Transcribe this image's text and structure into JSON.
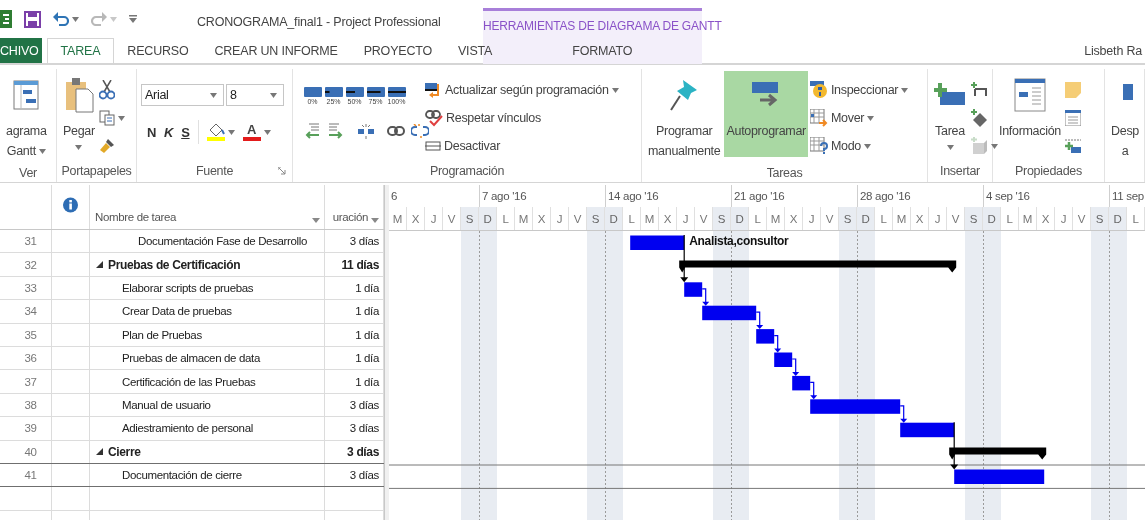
{
  "window": {
    "title": "CRONOGRAMA_final1 - Project Professional",
    "context_title": "HERRAMIENTAS DE DIAGRAMA DE GANTT",
    "user": "Lisbeth Ra"
  },
  "quick_access": [
    {
      "kind": "app",
      "disabled": false
    },
    {
      "kind": "save",
      "disabled": false
    },
    {
      "kind": "undo",
      "disabled": false
    },
    {
      "kind": "redo",
      "disabled": true
    },
    {
      "kind": "customize",
      "disabled": false
    }
  ],
  "tabs": [
    {
      "label": "CHIVO",
      "kind": "file",
      "selected": false
    },
    {
      "label": "TAREA",
      "kind": "tab",
      "selected": true
    },
    {
      "label": "RECURSO",
      "kind": "tab",
      "selected": false
    },
    {
      "label": "CREAR UN INFORME",
      "kind": "tab",
      "selected": false
    },
    {
      "label": "PROYECTO",
      "kind": "tab",
      "selected": false
    },
    {
      "label": "VISTA",
      "kind": "tab",
      "selected": false
    },
    {
      "label": "FORMATO",
      "kind": "contextual",
      "selected": false
    }
  ],
  "ribbon": {
    "groups": [
      {
        "label": "Ver",
        "items": [
          {
            "kind": "large",
            "lines": [
              "agrama",
              "Gantt"
            ],
            "dropdown": true,
            "selected": false
          }
        ]
      },
      {
        "label": "Portapapeles",
        "items": [
          {
            "kind": "large",
            "lines": [
              "Pegar"
            ],
            "dropdown": true,
            "selected": false
          },
          {
            "kind": "stack",
            "items": [
              {
                "dropdown": false
              },
              {
                "dropdown": true
              },
              {
                "dropdown": false
              }
            ]
          }
        ]
      },
      {
        "label": "Fuente",
        "items": [
          {
            "kind": "font",
            "font": "Arial",
            "size": "8",
            "styles": [
              "N",
              "K",
              "S"
            ],
            "font_color": "A"
          }
        ]
      },
      {
        "label": "Programación",
        "items": [
          {
            "kind": "progress_grid",
            "percents": [
              "0%",
              "25%",
              "50%",
              "75%",
              "100%"
            ]
          },
          {
            "kind": "stack",
            "items": [
              {
                "label": "Actualizar según programación",
                "dropdown": true
              },
              {
                "label": "Respetar vínculos",
                "dropdown": false
              },
              {
                "label": "Desactivar",
                "dropdown": false
              }
            ]
          }
        ]
      },
      {
        "label": "Tareas",
        "items": [
          {
            "kind": "large",
            "lines": [
              "Programar",
              "manualmente"
            ],
            "dropdown": false,
            "selected": false
          },
          {
            "kind": "large",
            "lines": [
              "Autoprogramar"
            ],
            "dropdown": false,
            "selected": true
          },
          {
            "kind": "stack",
            "items": [
              {
                "label": "Inspeccionar",
                "dropdown": true
              },
              {
                "label": "Mover",
                "dropdown": true
              },
              {
                "label": "Modo",
                "dropdown": true
              }
            ]
          }
        ]
      },
      {
        "label": "Insertar",
        "items": [
          {
            "kind": "large",
            "lines": [
              "Tarea"
            ],
            "dropdown": true,
            "selected": false
          },
          {
            "kind": "stack",
            "items": [
              {
                "dropdown": false
              },
              {
                "dropdown": false
              },
              {
                "dropdown": true
              }
            ]
          }
        ]
      },
      {
        "label": "Propiedades",
        "items": [
          {
            "kind": "large",
            "lines": [
              "Información"
            ],
            "dropdown": false,
            "selected": false
          },
          {
            "kind": "stack",
            "items": [
              {
                "dropdown": false
              },
              {
                "dropdown": false
              },
              {
                "dropdown": false
              }
            ]
          }
        ]
      },
      {
        "items": [
          {
            "kind": "large",
            "lines": [
              "Desp",
              "a"
            ],
            "dropdown": false,
            "selected": false
          }
        ]
      }
    ]
  },
  "table": {
    "columns": [
      "Nombre de tarea",
      "uración"
    ],
    "rows": [
      {
        "id": "31",
        "name": "Documentación Fase de Desarrollo",
        "duration": "3 días",
        "kind": "task",
        "resources": "Analista,consultor",
        "selected": false
      },
      {
        "id": "32",
        "name": "Pruebas de Certificación",
        "duration": "11 días",
        "kind": "summary",
        "expanded": true,
        "selected": false,
        "children": [
          {
            "id": "33",
            "name": "Elaborar scripts de pruebas",
            "duration": "1 día",
            "kind": "task",
            "selected": false
          },
          {
            "id": "34",
            "name": "Crear Data de pruebas",
            "duration": "1 día",
            "kind": "task",
            "selected": false
          },
          {
            "id": "35",
            "name": "Plan de Pruebas",
            "duration": "1 día",
            "kind": "task",
            "selected": false
          },
          {
            "id": "36",
            "name": "Pruebas de almacen de data",
            "duration": "1 día",
            "kind": "task",
            "selected": false
          },
          {
            "id": "37",
            "name": "Certificación de las Pruebas",
            "duration": "1 día",
            "kind": "task",
            "selected": false
          },
          {
            "id": "38",
            "name": "Manual de usuario",
            "duration": "3 días",
            "kind": "task",
            "selected": false
          },
          {
            "id": "39",
            "name": "Adiestramiento de personal",
            "duration": "3 días",
            "kind": "task",
            "selected": false
          }
        ]
      },
      {
        "id": "40",
        "name": "Cierre",
        "duration": "3 días",
        "kind": "summary",
        "expanded": true,
        "selected": false,
        "children": [
          {
            "id": "41",
            "name": "Documentación de cierre",
            "duration": "3 días",
            "kind": "task",
            "selected": true
          }
        ]
      }
    ]
  },
  "gantt": {
    "weeks": [
      {
        "label": "6",
        "days": [
          {
            "letter": "M",
            "nonworking": false
          },
          {
            "letter": "X",
            "nonworking": false
          },
          {
            "letter": "J",
            "nonworking": false
          },
          {
            "letter": "V",
            "nonworking": false
          },
          {
            "letter": "S",
            "nonworking": true
          }
        ]
      },
      {
        "label": "7 ago '16",
        "days": [
          {
            "letter": "D",
            "nonworking": true
          },
          {
            "letter": "L",
            "nonworking": false
          },
          {
            "letter": "M",
            "nonworking": false
          },
          {
            "letter": "X",
            "nonworking": false
          },
          {
            "letter": "J",
            "nonworking": false
          },
          {
            "letter": "V",
            "nonworking": false
          },
          {
            "letter": "S",
            "nonworking": true
          }
        ]
      },
      {
        "label": "14 ago '16",
        "days": [
          {
            "letter": "D",
            "nonworking": true
          },
          {
            "letter": "L",
            "nonworking": false
          },
          {
            "letter": "M",
            "nonworking": false
          },
          {
            "letter": "X",
            "nonworking": false
          },
          {
            "letter": "J",
            "nonworking": false
          },
          {
            "letter": "V",
            "nonworking": false
          },
          {
            "letter": "S",
            "nonworking": true
          }
        ]
      },
      {
        "label": "21 ago '16",
        "days": [
          {
            "letter": "D",
            "nonworking": true
          },
          {
            "letter": "L",
            "nonworking": false
          },
          {
            "letter": "M",
            "nonworking": false
          },
          {
            "letter": "X",
            "nonworking": false
          },
          {
            "letter": "J",
            "nonworking": false
          },
          {
            "letter": "V",
            "nonworking": false
          },
          {
            "letter": "S",
            "nonworking": true
          }
        ]
      },
      {
        "label": "28 ago '16",
        "days": [
          {
            "letter": "D",
            "nonworking": true
          },
          {
            "letter": "L",
            "nonworking": false
          },
          {
            "letter": "M",
            "nonworking": false
          },
          {
            "letter": "X",
            "nonworking": false
          },
          {
            "letter": "J",
            "nonworking": false
          },
          {
            "letter": "V",
            "nonworking": false
          },
          {
            "letter": "S",
            "nonworking": true
          }
        ]
      },
      {
        "label": "4 sep '16",
        "days": [
          {
            "letter": "D",
            "nonworking": true
          },
          {
            "letter": "L",
            "nonworking": false
          },
          {
            "letter": "M",
            "nonworking": false
          },
          {
            "letter": "X",
            "nonworking": false
          },
          {
            "letter": "J",
            "nonworking": false
          },
          {
            "letter": "V",
            "nonworking": false
          },
          {
            "letter": "S",
            "nonworking": true
          }
        ]
      },
      {
        "label": "11 sep",
        "days": [
          {
            "letter": "D",
            "nonworking": true
          },
          {
            "letter": "L",
            "nonworking": false
          }
        ]
      }
    ]
  }
}
